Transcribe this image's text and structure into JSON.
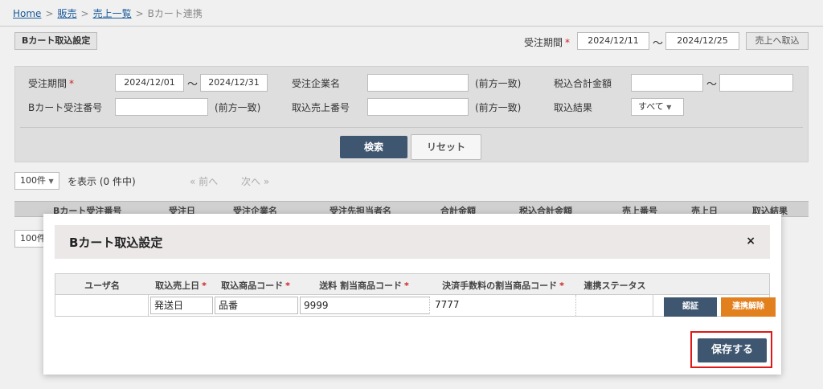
{
  "breadcrumb": [
    {
      "label": "Home",
      "link": true
    },
    {
      "label": "販売",
      "link": true
    },
    {
      "label": "売上一覧",
      "link": true
    },
    {
      "label": "Bカート連携",
      "link": false
    }
  ],
  "breadcrumb_sep": ">",
  "toolbar": {
    "settings_button": "Bカート取込設定",
    "period_label": "受注期間",
    "required_mark": "*",
    "date_from": "2024/12/11",
    "tilde": "〜",
    "date_to": "2024/12/25",
    "import_button": "売上へ取込"
  },
  "search": {
    "order_period_label": "受注期間",
    "required_mark": "*",
    "order_from": "2024/12/01",
    "tilde": "〜",
    "order_to": "2024/12/31",
    "company_label": "受注企業名",
    "company_value": "",
    "partial_match": "(前方一致)",
    "total_tax_label": "税込合計金額",
    "total_tax_from": "",
    "total_tax_to": "",
    "bcart_order_label": "Bカート受注番号",
    "bcart_order_value": "",
    "sales_no_label": "取込売上番号",
    "sales_no_value": "",
    "result_label": "取込結果",
    "result_value": "すべて",
    "search_button": "検索",
    "reset_button": "リセット"
  },
  "pager": {
    "per_page": "100件",
    "display_text": "を表示 (0 件中)",
    "prev": "« 前へ",
    "next": "次へ »"
  },
  "list_columns": [
    "Bカート受注番号",
    "受注日",
    "受注企業名",
    "受注先担当者名",
    "合計金額",
    "税込合計金額",
    "売上番号",
    "売上日",
    "取込結果"
  ],
  "modal": {
    "title": "Bカート取込設定",
    "close": "×",
    "columns": [
      {
        "label": "ユーザ名",
        "required": false
      },
      {
        "label": "取込売上日",
        "required": true
      },
      {
        "label": "取込商品コード",
        "required": true
      },
      {
        "label": "送料 割当商品コード",
        "required": true
      },
      {
        "label": "決済手数料の割当商品コード",
        "required": true
      },
      {
        "label": "連携ステータス",
        "required": false
      }
    ],
    "required_mark": "*",
    "row": {
      "user_name": "",
      "sales_date": "発送日",
      "product_code": "品番",
      "shipping_code": "9999",
      "fee_code": "7777",
      "status": ""
    },
    "auth_button": "認証",
    "unlink_button": "連携解除",
    "save_button": "保存する"
  },
  "colors": {
    "primary": "#3f5670",
    "accent": "#e3801e",
    "highlight": "#e01818",
    "required": "#d02020"
  }
}
